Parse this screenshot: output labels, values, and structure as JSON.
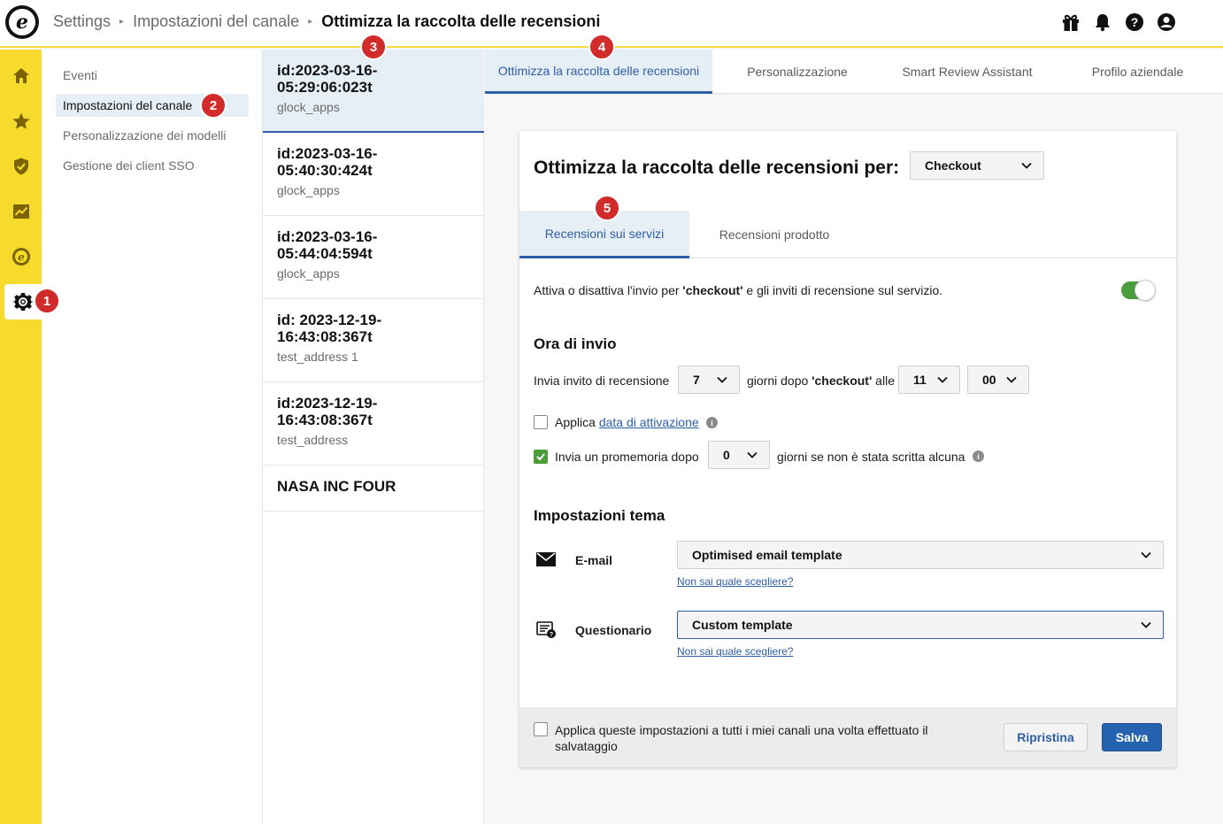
{
  "header": {
    "breadcrumb": [
      "Settings",
      "Impostazioni del canale"
    ],
    "current": "Ottimizza la raccolta delle recensioni",
    "icons": [
      "gift-icon",
      "bell-icon",
      "help-icon",
      "user-icon"
    ]
  },
  "rail": {
    "icons": [
      "home-icon",
      "star-icon",
      "shield-icon",
      "chart-icon",
      "trusted-icon",
      "gear-icon"
    ]
  },
  "subnav": {
    "items": [
      {
        "label": "Eventi"
      },
      {
        "label": "Impostazioni del canale"
      },
      {
        "label": "Personalizzazione dei modelli"
      },
      {
        "label": "Gestione dei client SSO"
      }
    ]
  },
  "channels": [
    {
      "id": "id:2023-03-16-05:29:06:023t",
      "sub": "glock_apps"
    },
    {
      "id": "id:2023-03-16-05:40:30:424t",
      "sub": "glock_apps"
    },
    {
      "id": "id:2023-03-16-05:44:04:594t",
      "sub": "glock_apps"
    },
    {
      "id": "id: 2023-12-19-16:43:08:367t",
      "sub": "test_address 1"
    },
    {
      "id": "id:2023-12-19-16:43:08:367t",
      "sub": "test_address"
    },
    {
      "id": "NASA INC FOUR",
      "sub": ""
    }
  ],
  "tabs": [
    {
      "label": "Ottimizza la raccolta delle recensioni"
    },
    {
      "label": "Personalizzazione"
    },
    {
      "label": "Smart Review Assistant"
    },
    {
      "label": "Profilo aziendale"
    }
  ],
  "card": {
    "title": "Ottimizza la raccolta delle recensioni per:",
    "event_select": "Checkout",
    "subtabs": [
      {
        "label": "Recensioni sui servizi"
      },
      {
        "label": "Recensioni prodotto"
      }
    ],
    "toggle_text_before": "Attiva o disattiva l'invio per ",
    "toggle_text_bold": "'checkout'",
    "toggle_text_after": " e gli inviti di recensione sul servizio.",
    "toggle_on": true,
    "send_time_heading": "Ora di invio",
    "send_invite_label": "Invia invito di recensione",
    "days_value": "7",
    "days_after_before": "giorni dopo ",
    "days_after_bold": "'checkout'",
    "days_after_after": " alle",
    "hour_value": "11",
    "minute_value": "00",
    "activation_prefix": "Applica ",
    "activation_link": "data di attivazione",
    "reminder_label": "Invia un promemoria dopo",
    "reminder_value": "0",
    "reminder_suffix": "giorni se non è stata scritta alcuna",
    "theme_heading": "Impostazioni tema",
    "email_label": "E-mail",
    "email_template": "Optimised email template",
    "email_help": "Non sai quale scegliere?",
    "questionnaire_label": "Questionario",
    "questionnaire_template": "Custom template",
    "questionnaire_help": "Non sai quale scegliere?",
    "apply_all_line1": "Applica queste impostazioni a tutti i miei canali una volta effettuato il",
    "apply_all_line2": "salvataggio",
    "reset_label": "Ripristina",
    "save_label": "Salva"
  },
  "markers": [
    "1",
    "2",
    "3",
    "4",
    "5"
  ],
  "colors": {
    "accent": "#2d5fa8",
    "rail": "#f6da2c",
    "toggle": "#4a9e3a",
    "marker": "#d12b2b"
  }
}
